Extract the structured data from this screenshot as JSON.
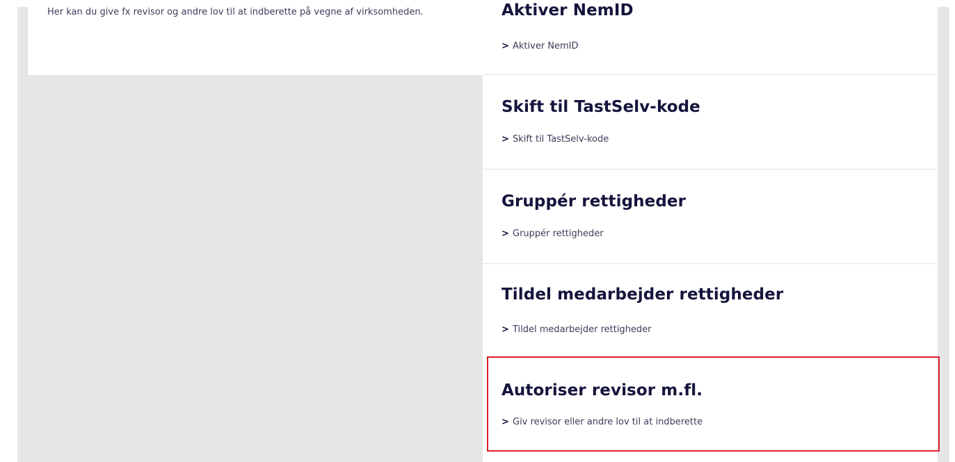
{
  "intro": {
    "description": "Her kan du give fx revisor og andre lov til at indberette på vegne af virksomheden."
  },
  "cards": [
    {
      "title": "Aktiver NemID",
      "link": "Aktiver NemID"
    },
    {
      "title": "Skift til TastSelv-kode",
      "link": "Skift til TastSelv-kode"
    },
    {
      "title": "Gruppér rettigheder",
      "link": "Gruppér rettigheder"
    },
    {
      "title": "Tildel medarbejder rettigheder",
      "link": "Tildel medarbejder rettigheder"
    },
    {
      "title": "Autoriser revisor m.fl.",
      "link": "Giv revisor eller andre lov til at indberette"
    }
  ],
  "icons": {
    "link_chevron": "chevron-right-icon"
  },
  "colors": {
    "highlight": "#d8202a",
    "heading": "#14143c",
    "background": "#e6e6e6"
  }
}
